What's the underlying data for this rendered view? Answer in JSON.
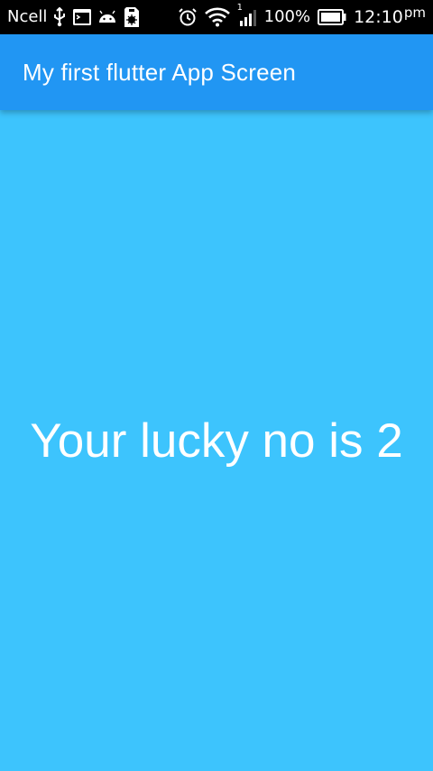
{
  "status_bar": {
    "carrier": "Ncell",
    "signal_badge": "1",
    "battery_percent": "100%",
    "time": "12:10",
    "ampm": "pm",
    "icons": [
      "usb-icon",
      "terminal-icon",
      "android-icon",
      "sim-icon",
      "alarm-icon",
      "wifi-icon",
      "signal-icon",
      "battery-icon"
    ]
  },
  "app_bar": {
    "title": "My first flutter App Screen"
  },
  "main": {
    "message": "Your lucky no is 2"
  },
  "colors": {
    "status_bar": "#000000",
    "app_bar": "#2196f3",
    "background": "#3dc4fd",
    "text": "#ffffff"
  }
}
